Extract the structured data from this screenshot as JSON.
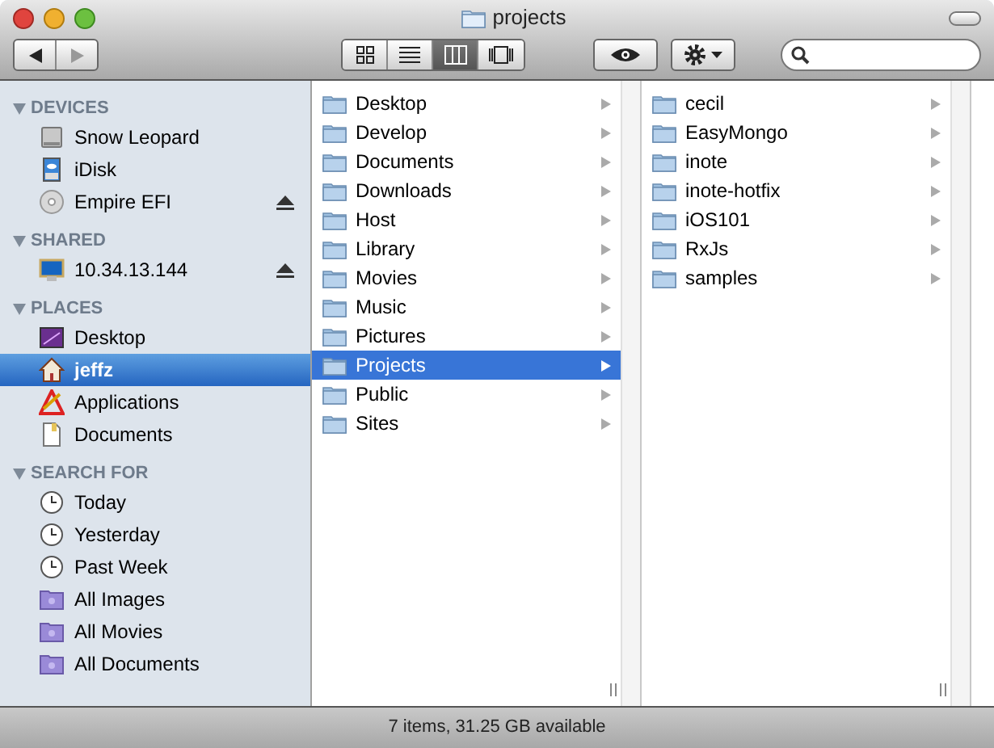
{
  "window": {
    "title": "projects"
  },
  "toolbar": {
    "views": [
      {
        "kind": "icons",
        "selected": false
      },
      {
        "kind": "list",
        "selected": false
      },
      {
        "kind": "columns",
        "selected": true
      },
      {
        "kind": "coverflow",
        "selected": false
      }
    ]
  },
  "sidebar": {
    "sections": [
      {
        "title": "DEVICES",
        "items": [
          {
            "label": "Snow Leopard",
            "kind": "drive",
            "selected": false,
            "eject": false
          },
          {
            "label": "iDisk",
            "kind": "idisk",
            "selected": false,
            "eject": false
          },
          {
            "label": "Empire EFI",
            "kind": "disc",
            "selected": false,
            "eject": true
          }
        ]
      },
      {
        "title": "SHARED",
        "items": [
          {
            "label": "10.34.13.144",
            "kind": "monitor",
            "selected": false,
            "eject": true
          }
        ]
      },
      {
        "title": "PLACES",
        "items": [
          {
            "label": "Desktop",
            "kind": "desktop",
            "selected": false,
            "eject": false
          },
          {
            "label": "jeffz",
            "kind": "home",
            "selected": true,
            "eject": false
          },
          {
            "label": "Applications",
            "kind": "apps",
            "selected": false,
            "eject": false
          },
          {
            "label": "Documents",
            "kind": "doc",
            "selected": false,
            "eject": false
          }
        ]
      },
      {
        "title": "SEARCH FOR",
        "items": [
          {
            "label": "Today",
            "kind": "clock",
            "selected": false,
            "eject": false
          },
          {
            "label": "Yesterday",
            "kind": "clock",
            "selected": false,
            "eject": false
          },
          {
            "label": "Past Week",
            "kind": "clock",
            "selected": false,
            "eject": false
          },
          {
            "label": "All Images",
            "kind": "smart",
            "selected": false,
            "eject": false
          },
          {
            "label": "All Movies",
            "kind": "smart",
            "selected": false,
            "eject": false
          },
          {
            "label": "All Documents",
            "kind": "smart",
            "selected": false,
            "eject": false
          }
        ]
      }
    ]
  },
  "columns": [
    {
      "items": [
        {
          "label": "Desktop",
          "selected": false
        },
        {
          "label": "Develop",
          "selected": false
        },
        {
          "label": "Documents",
          "selected": false
        },
        {
          "label": "Downloads",
          "selected": false
        },
        {
          "label": "Host",
          "selected": false
        },
        {
          "label": "Library",
          "selected": false
        },
        {
          "label": "Movies",
          "selected": false
        },
        {
          "label": "Music",
          "selected": false
        },
        {
          "label": "Pictures",
          "selected": false
        },
        {
          "label": "Projects",
          "selected": true
        },
        {
          "label": "Public",
          "selected": false
        },
        {
          "label": "Sites",
          "selected": false
        }
      ]
    },
    {
      "items": [
        {
          "label": "cecil",
          "selected": false
        },
        {
          "label": "EasyMongo",
          "selected": false
        },
        {
          "label": "inote",
          "selected": false
        },
        {
          "label": "inote-hotfix",
          "selected": false
        },
        {
          "label": "iOS101",
          "selected": false
        },
        {
          "label": "RxJs",
          "selected": false
        },
        {
          "label": "samples",
          "selected": false
        }
      ]
    }
  ],
  "status_bar": {
    "text": "7 items, 31.25 GB available"
  }
}
